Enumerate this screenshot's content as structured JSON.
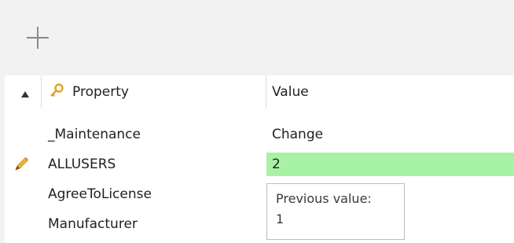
{
  "toolbar": {
    "add_icon": "plus-icon"
  },
  "table": {
    "sort_indicator": "sort-ascending-triangle",
    "columns": {
      "property": "Property",
      "value": "Value"
    },
    "property_icon": "key-icon",
    "rows": [
      {
        "name": "_Maintenance",
        "value": "Change",
        "modified": false
      },
      {
        "name": "ALLUSERS",
        "value": "2",
        "modified": true,
        "indicator_icon": "pencil-icon"
      },
      {
        "name": "AgreeToLicense",
        "value": "",
        "modified": false
      },
      {
        "name": "Manufacturer",
        "value": "",
        "modified": false
      }
    ]
  },
  "tooltip": {
    "label": "Previous value:",
    "value": "1"
  },
  "colors": {
    "modified_bg": "#a8f2a4",
    "toolbar_bg": "#f2f2f2",
    "pencil": "#e8a93a",
    "key": "#e0a21f"
  }
}
